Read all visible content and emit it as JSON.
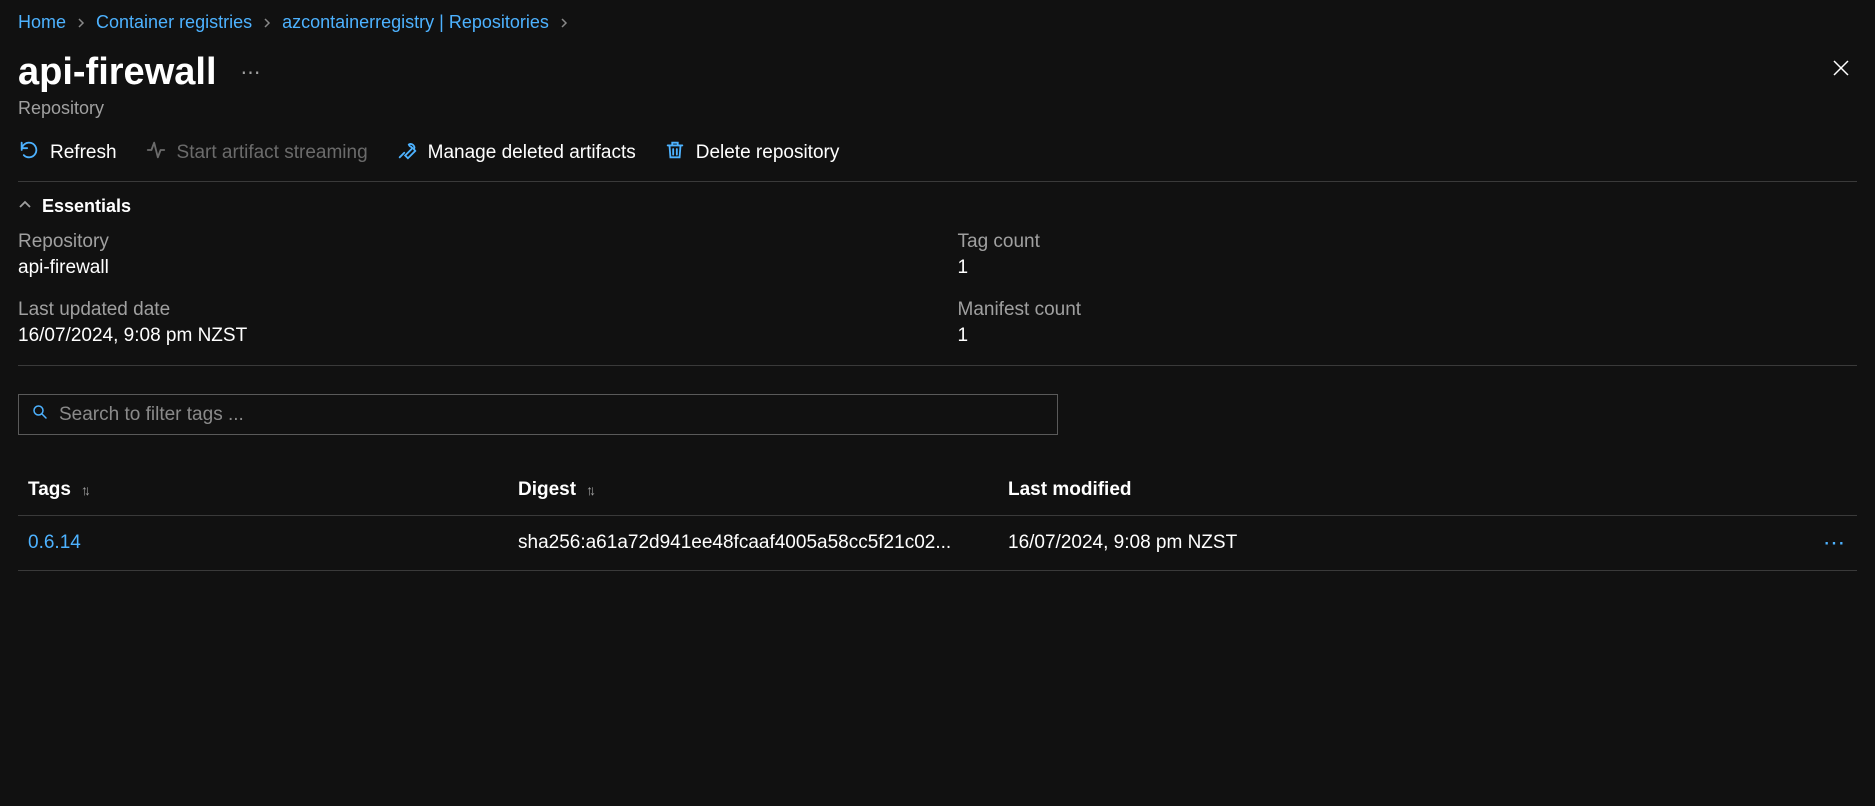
{
  "breadcrumb": {
    "home": "Home",
    "registries": "Container registries",
    "repo": "azcontainerregistry | Repositories"
  },
  "page": {
    "title": "api-firewall",
    "subtitle": "Repository"
  },
  "toolbar": {
    "refresh": "Refresh",
    "start_streaming": "Start artifact streaming",
    "manage_deleted": "Manage deleted artifacts",
    "delete_repo": "Delete repository"
  },
  "essentials": {
    "label": "Essentials",
    "repository_label": "Repository",
    "repository_value": "api-firewall",
    "tag_count_label": "Tag count",
    "tag_count_value": "1",
    "last_updated_label": "Last updated date",
    "last_updated_value": "16/07/2024, 9:08 pm NZST",
    "manifest_count_label": "Manifest count",
    "manifest_count_value": "1"
  },
  "search": {
    "placeholder": "Search to filter tags ..."
  },
  "table": {
    "headers": {
      "tags": "Tags",
      "digest": "Digest",
      "last_modified": "Last modified"
    },
    "rows": [
      {
        "tag": "0.6.14",
        "digest": "sha256:a61a72d941ee48fcaaf4005a58cc5f21c02...",
        "last_modified": "16/07/2024, 9:08 pm NZST"
      }
    ]
  }
}
